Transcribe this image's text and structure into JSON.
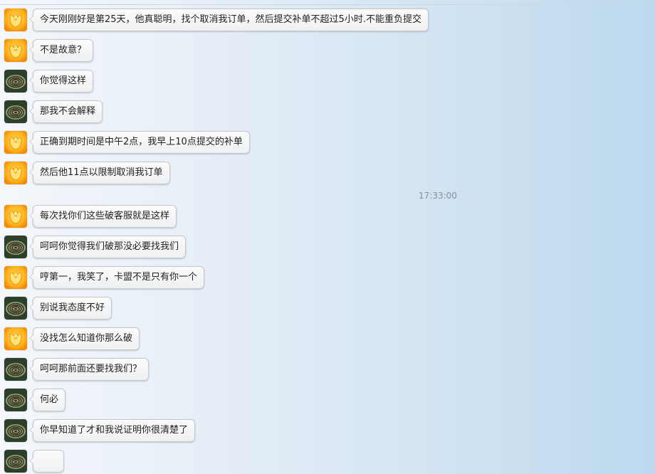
{
  "chat": {
    "timestamp": "17:33:00",
    "messages": [
      {
        "sender": "yellow-avatar",
        "text": "今天刚刚好是第25天，他真聪明，找个取消我订单，然后提交补单不超过5小时.不能重负提交"
      },
      {
        "sender": "yellow-avatar",
        "text": "不是故意？"
      },
      {
        "sender": "green-avatar",
        "text": "你觉得这样"
      },
      {
        "sender": "green-avatar",
        "text": "那我不会解释"
      },
      {
        "sender": "yellow-avatar",
        "text": "正确到期时间是中午2点，我早上10点提交的补单"
      },
      {
        "sender": "yellow-avatar",
        "text": "然后他11点以限制取消我订单"
      },
      {
        "sender": "yellow-avatar",
        "text": "每次找你们这些破客服就是这样"
      },
      {
        "sender": "green-avatar",
        "text": "呵呵你觉得我们破那没必要找我们"
      },
      {
        "sender": "yellow-avatar",
        "text": "哼第一，我笑了，卡盟不是只有你一个"
      },
      {
        "sender": "green-avatar",
        "text": "别说我态度不好"
      },
      {
        "sender": "yellow-avatar",
        "text": "没找怎么知道你那么破"
      },
      {
        "sender": "green-avatar",
        "text": "呵呵那前面还要找我们？"
      },
      {
        "sender": "green-avatar",
        "text": "何必"
      },
      {
        "sender": "green-avatar",
        "text": "你早知道了才和我说证明你很清楚了"
      },
      {
        "sender": "green-avatar",
        "text": ""
      }
    ]
  }
}
